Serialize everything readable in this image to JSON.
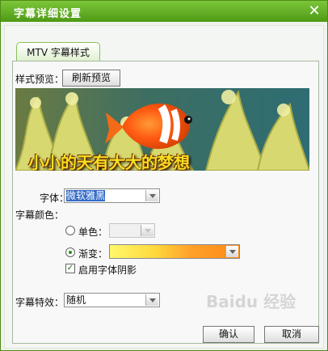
{
  "window": {
    "title": "字幕详细设置",
    "close_symbol": "✕"
  },
  "tab": {
    "label": "MTV 字幕样式"
  },
  "style_preview": {
    "label": "样式预览：",
    "refresh_button": "刷新预览",
    "sample_text": "小小的天有大大的梦想"
  },
  "font": {
    "label": "字体：",
    "selected": "微软雅黑"
  },
  "subtitle_color": {
    "label": "字幕颜色：",
    "single_color": {
      "label": "单色：",
      "selected": false
    },
    "gradient": {
      "label": "渐变：",
      "selected": true
    },
    "enable_shadow": {
      "label": "启用字体阴影",
      "checked": true
    }
  },
  "subtitle_effect": {
    "label": "字幕特效：",
    "selected": "随机"
  },
  "footer": {
    "confirm_label": "确认",
    "cancel_label": "取消",
    "watermark_text": "Baidu 经验"
  },
  "colors": {
    "title_bar": "#5ba61f",
    "gradient_start": "#fff86a",
    "gradient_end": "#ff8a16"
  },
  "icons": {
    "close": "close-icon",
    "dropdown": "chevron-down-icon",
    "checkmark": "checkmark-icon"
  }
}
